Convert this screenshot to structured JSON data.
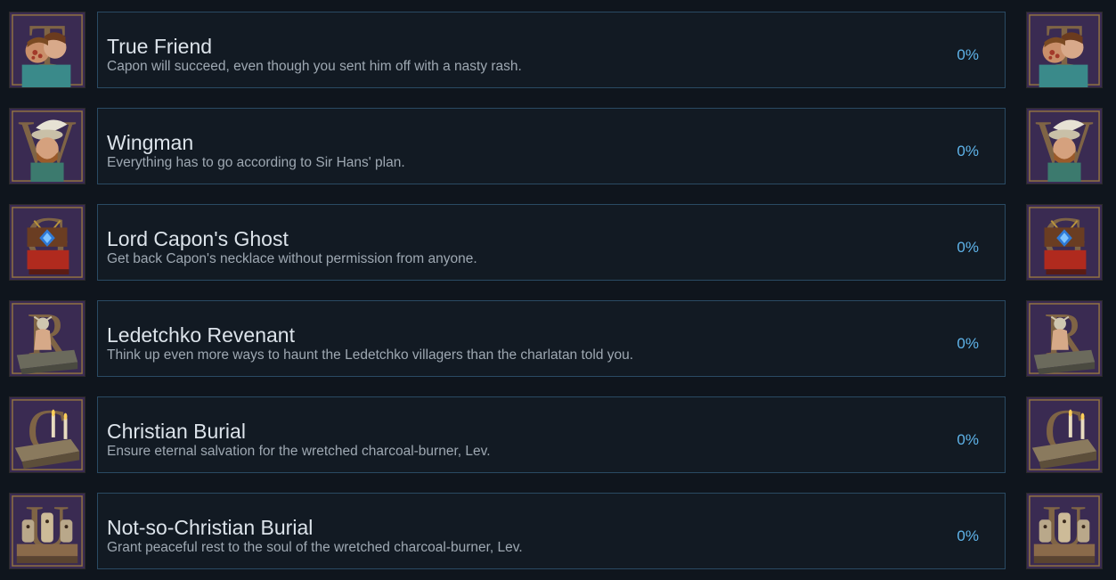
{
  "achievements": [
    {
      "title": "True Friend",
      "description": "Capon will succeed, even though you sent him off with a nasty rash.",
      "percent": "0%",
      "icon": "two-faces-icon",
      "letter": "T"
    },
    {
      "title": "Wingman",
      "description": "Everything has to go according to Sir Hans' plan.",
      "percent": "0%",
      "icon": "feathered-hat-man-icon",
      "letter": "W"
    },
    {
      "title": "Lord Capon's Ghost",
      "description": "Get back Capon's necklace without permission from anyone.",
      "percent": "0%",
      "icon": "necklace-chest-icon",
      "letter": "G"
    },
    {
      "title": "Ledetchko Revenant",
      "description": "Think up even more ways to haunt the Ledetchko villagers than the charlatan told you.",
      "percent": "0%",
      "icon": "revenant-coffin-icon",
      "letter": "R"
    },
    {
      "title": "Christian Burial",
      "description": "Ensure eternal salvation for the wretched charcoal-burner, Lev.",
      "percent": "0%",
      "icon": "coffin-candles-icon",
      "letter": "C"
    },
    {
      "title": "Not-so-Christian Burial",
      "description": "Grant peaceful rest to the soul of the wretched charcoal-burner, Lev.",
      "percent": "0%",
      "icon": "idols-figures-icon",
      "letter": "U"
    }
  ],
  "colors": {
    "background": "#0f151d",
    "panel_border": "#2a4a63",
    "title": "#dce3ea",
    "description": "#9ea8b2",
    "percent": "#5fb4ea",
    "icon_frame": "#3a2b52",
    "icon_gold": "#b8933c"
  }
}
